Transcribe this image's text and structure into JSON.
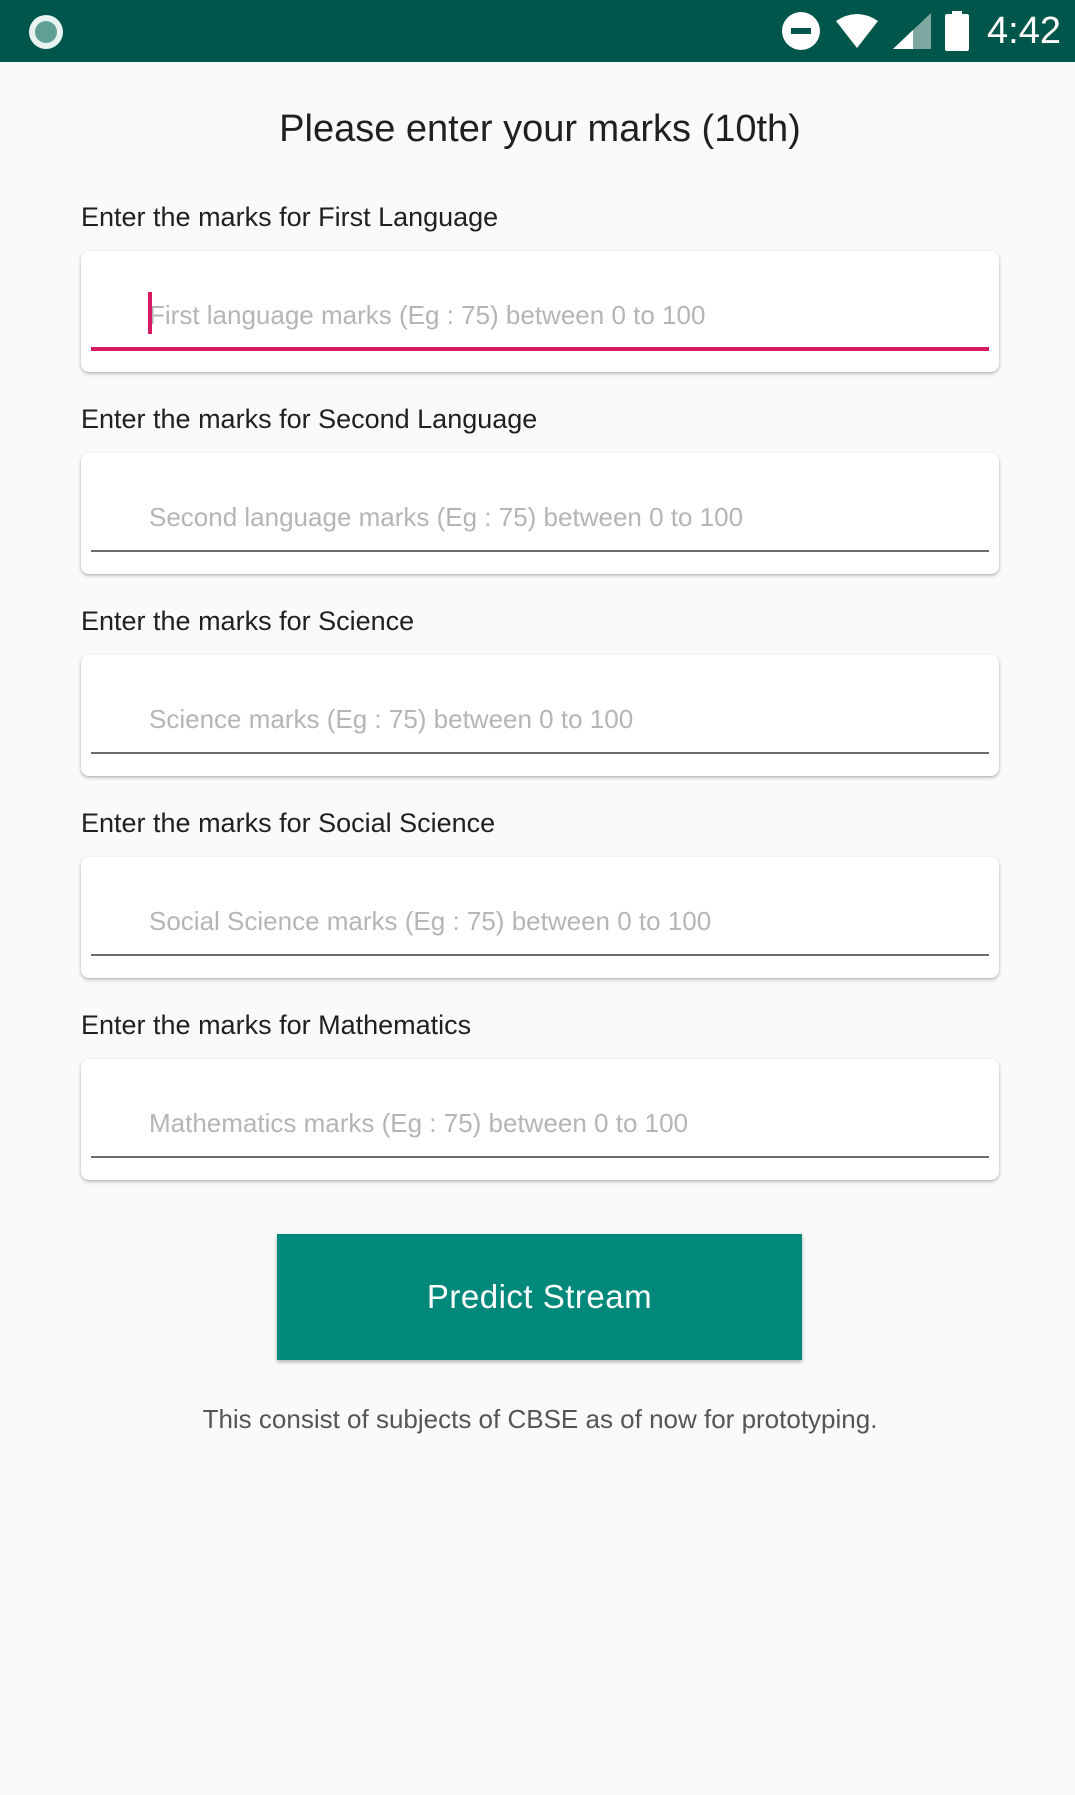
{
  "status_bar": {
    "time": "4:42",
    "color": "#00564a",
    "icons": [
      "app-notification-icon",
      "do-not-disturb-icon",
      "wifi-icon",
      "cellular-signal-icon",
      "battery-icon"
    ]
  },
  "title": "Please enter your marks (10th)",
  "fields": [
    {
      "label": "Enter the marks for First Language",
      "placeholder": "First language marks (Eg : 75) between 0 to 100",
      "value": "",
      "focused": true
    },
    {
      "label": "Enter the marks for Second Language",
      "placeholder": "Second language marks (Eg : 75) between 0 to 100",
      "value": "",
      "focused": false
    },
    {
      "label": "Enter the marks for Science",
      "placeholder": "Science marks (Eg : 75) between 0 to 100",
      "value": "",
      "focused": false
    },
    {
      "label": "Enter the marks for Social Science",
      "placeholder": "Social Science marks (Eg : 75) between 0 to 100",
      "value": "",
      "focused": false
    },
    {
      "label": "Enter the marks for Mathematics",
      "placeholder": "Mathematics marks (Eg : 75) between 0 to 100",
      "value": "",
      "focused": false
    }
  ],
  "predict_button": {
    "label": "Predict Stream"
  },
  "footnote": "This consist of subjects of CBSE as of now for prototyping.",
  "colors": {
    "accent": "#d81b60",
    "primary": "#00897b",
    "status_bar": "#00564a",
    "background": "#fafafa"
  }
}
